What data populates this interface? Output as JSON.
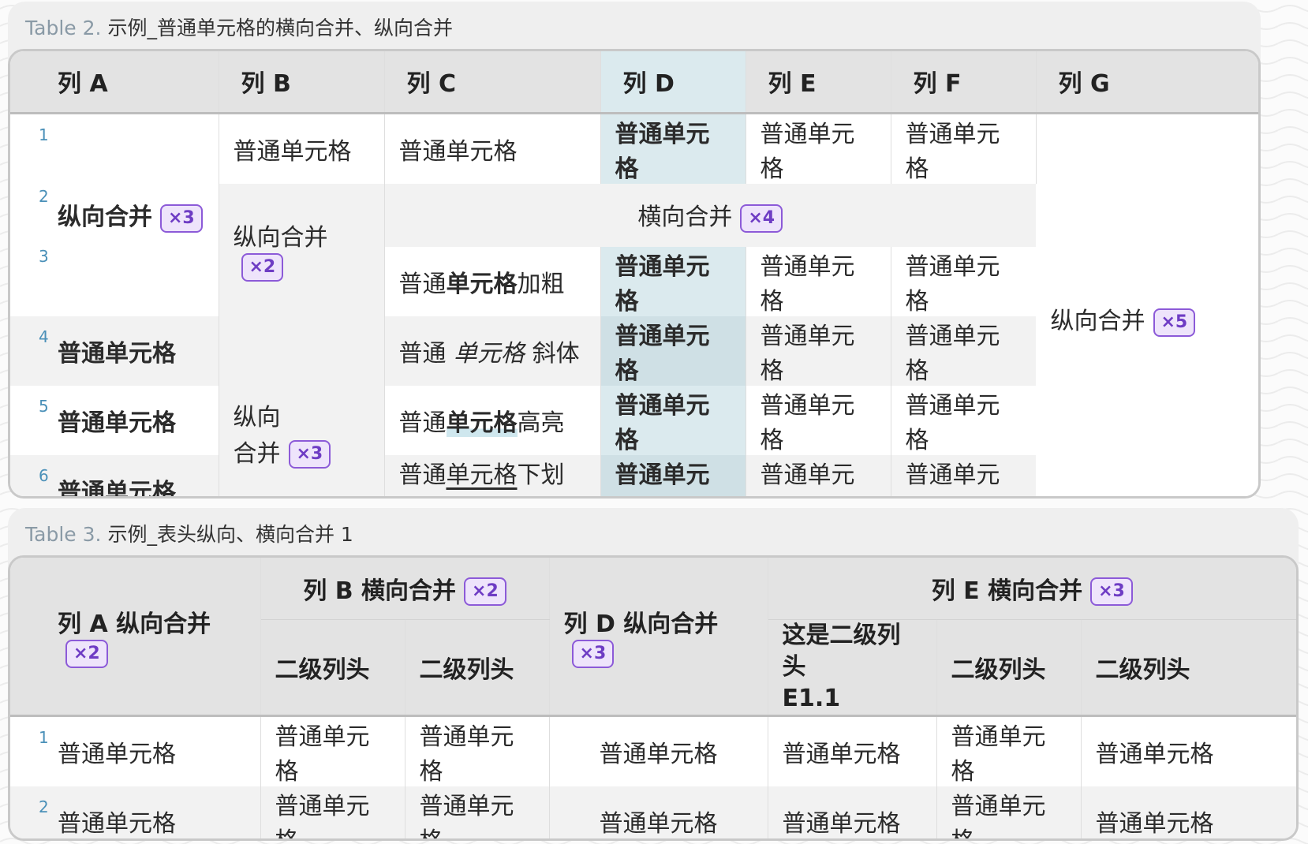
{
  "table2": {
    "caption_label": "Table 2.",
    "caption_text": "示例_普通单元格的横向合并、纵向合并",
    "headers": [
      "列 A",
      "列 B",
      "列 C",
      "列 D",
      "列 E",
      "列 F",
      "列 G"
    ],
    "row_numbers": [
      "1",
      "2",
      "3",
      "4",
      "5",
      "6"
    ],
    "cell": "普通单元格",
    "colA_merge": {
      "text": "纵向合并",
      "badge": "×3"
    },
    "colB_merge1": {
      "text": "纵向合并",
      "badge": "×2"
    },
    "colB_merge2": {
      "line1": "纵向",
      "line2": "合并",
      "badge": "×3"
    },
    "h_merge": {
      "text": "横向合并",
      "badge": "×4"
    },
    "colG_merge": {
      "text": "纵向合并",
      "badge": "×5"
    },
    "bold_cell": {
      "pre": "普通",
      "bold": "单元格",
      "post": "加粗"
    },
    "italic_cell": {
      "pre": "普通 ",
      "italic": "单元格",
      "post": " 斜体"
    },
    "highlight_cell": {
      "pre": "普通",
      "highlight": "单元格",
      "post": "高亮"
    },
    "underline_cell": {
      "pre": "普通",
      "underline": "单元格",
      "post": "下划线"
    }
  },
  "table3": {
    "caption_label": "Table 3.",
    "caption_text": "示例_表头纵向、横向合并 1",
    "colA_header": {
      "text": "列 A 纵向合并",
      "badge": "×2"
    },
    "colB_header": {
      "text": "列 B 横向合并",
      "badge": "×2"
    },
    "colD_header": {
      "text": "列 D 纵向合并",
      "badge": "×3"
    },
    "colE_header": {
      "text": "列 E 横向合并",
      "badge": "×3"
    },
    "sub_header": "二级列头",
    "sub_header_e1_line1": "这是二级列头",
    "sub_header_e1_line2": "E1.1",
    "row_numbers": [
      "1",
      "2"
    ],
    "cell": "普通单元格"
  }
}
